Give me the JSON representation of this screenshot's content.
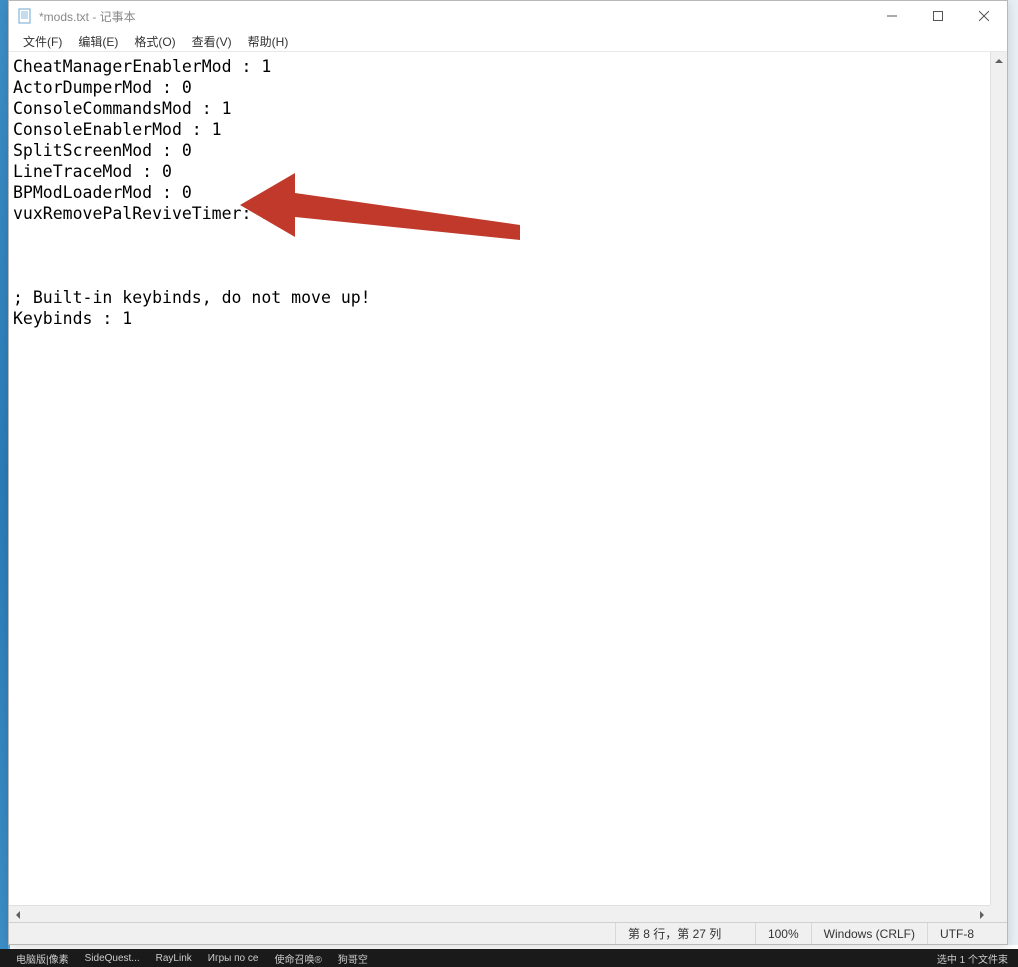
{
  "window": {
    "title": "*mods.txt - 记事本",
    "app_name": "记事本"
  },
  "menu": {
    "file": "文件(F)",
    "edit": "编辑(E)",
    "format": "格式(O)",
    "view": "查看(V)",
    "help": "帮助(H)"
  },
  "content": {
    "lines": [
      "CheatManagerEnablerMod : 1",
      "ActorDumperMod : 0",
      "ConsoleCommandsMod : 1",
      "ConsoleEnablerMod : 1",
      "SplitScreenMod : 0",
      "LineTraceMod : 0",
      "BPModLoaderMod : 0",
      "vuxRemovePalReviveTimer: 1",
      "",
      "",
      "",
      "; Built-in keybinds, do not move up!",
      "Keybinds : 1"
    ]
  },
  "statusbar": {
    "position": "第 8 行，第 27 列",
    "zoom": "100%",
    "line_ending": "Windows (CRLF)",
    "encoding": "UTF-8"
  },
  "taskbar": {
    "items": [
      "电脑版|像素",
      "SideQuest...",
      "RayLink",
      "Игры по се",
      "使命召唤®",
      "狗哥空"
    ],
    "right": "选中 1 个文件束"
  },
  "annotation": {
    "arrow_color": "#c0392b"
  }
}
